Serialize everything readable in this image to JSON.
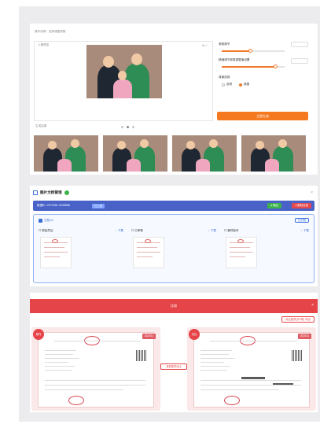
{
  "panel1": {
    "hint": "操作说明：选择调整参数",
    "preview_label": "人像预览",
    "tools": "⊕ ⤢",
    "params": {
      "p1_label": "参数调节",
      "p1_value": "",
      "p2_label": "精细调节参数调整值设置",
      "p2_value": "",
      "radio_label": "背景选择",
      "radio_a": "选项",
      "radio_b": "原图",
      "radio_b_checked": true,
      "p1_level": 0.45,
      "p2_level": 0.85
    },
    "generate_button": "立即生成",
    "results_label": "生成结果",
    "result_count": 4,
    "accent": "#f57a1f"
  },
  "panel2": {
    "title": "图片文档管理",
    "id_text": "数据ID: 2073281-0335856",
    "chip": "已上传",
    "btn_green": "● 确定",
    "btn_red": "● 删除全部",
    "group_label": "文档 #1",
    "group_tag": "已识别",
    "docs": [
      {
        "caption": "☐ 原始凭证",
        "download": "↓ 下载"
      },
      {
        "caption": "☐ 已审核",
        "download": "↓ 下载"
      },
      {
        "caption": "☐ 最终版本",
        "download": "↓ 下载"
      }
    ],
    "bar_color": "#4862c8"
  },
  "panel3": {
    "title": "比较",
    "close": "×",
    "top_link": "对比差异(共3项) 导出",
    "left_ribbon": "原件",
    "right_ribbon": "对比",
    "left_badge": "2020/11",
    "right_badge": "2020/11",
    "middle_button": "查看差异对比",
    "accent": "#e54449"
  }
}
